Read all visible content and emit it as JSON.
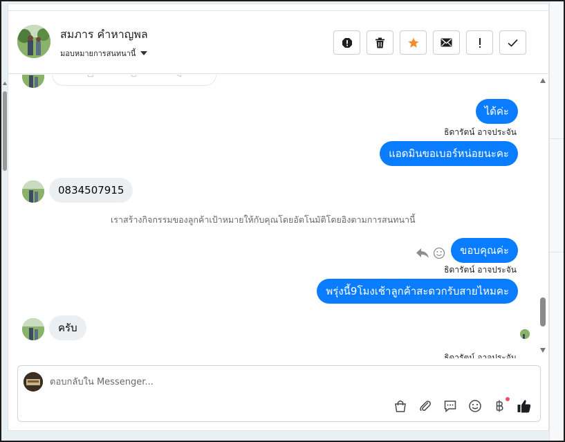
{
  "header": {
    "contact_name": "สมภาร คำหาญพล",
    "assign_label": "มอบหมายการสนทนานี้",
    "actions": [
      "alert-octagon",
      "trash",
      "star",
      "envelope",
      "exclamation",
      "checkmark"
    ]
  },
  "messages": [
    {
      "dir": "out",
      "text": "ได้ค่ะ"
    },
    {
      "dir": "sender",
      "text": "ธิดารัตน์ อาจประจัน"
    },
    {
      "dir": "out",
      "text": "แอดมินขอเบอร์หน่อยนะคะ"
    },
    {
      "dir": "in",
      "text": "0834507915"
    },
    {
      "dir": "system",
      "text": "เราสร้างกิจกรรมของลูกค้าเป้าหมายให้กับคุณโดยอัตโนมัติโดยอิงตามการสนทนานี้"
    },
    {
      "dir": "out",
      "text": "ขอบคุณค่ะ"
    },
    {
      "dir": "sender",
      "text": "ธิดารัตน์ อาจประจัน"
    },
    {
      "dir": "out",
      "text": "พรุ่งนี้9โมงเช้าลูกค้าสะดวกรับสายไหมคะ"
    },
    {
      "dir": "in",
      "text": "ครับ"
    },
    {
      "dir": "sender",
      "text": "ธิดารัตน์ อาจประจัน"
    }
  ],
  "composer": {
    "placeholder": "ตอบกลับใน Messenger...",
    "tools": [
      "shopping-bag",
      "paperclip",
      "saved-reply",
      "emoji",
      "baht-payment",
      "thumbs-up"
    ]
  },
  "colors": {
    "outgoing_bubble": "#0a7cff",
    "incoming_bubble": "#eceff1",
    "star": "#f28c28",
    "notification_dot": "#f0506e"
  }
}
